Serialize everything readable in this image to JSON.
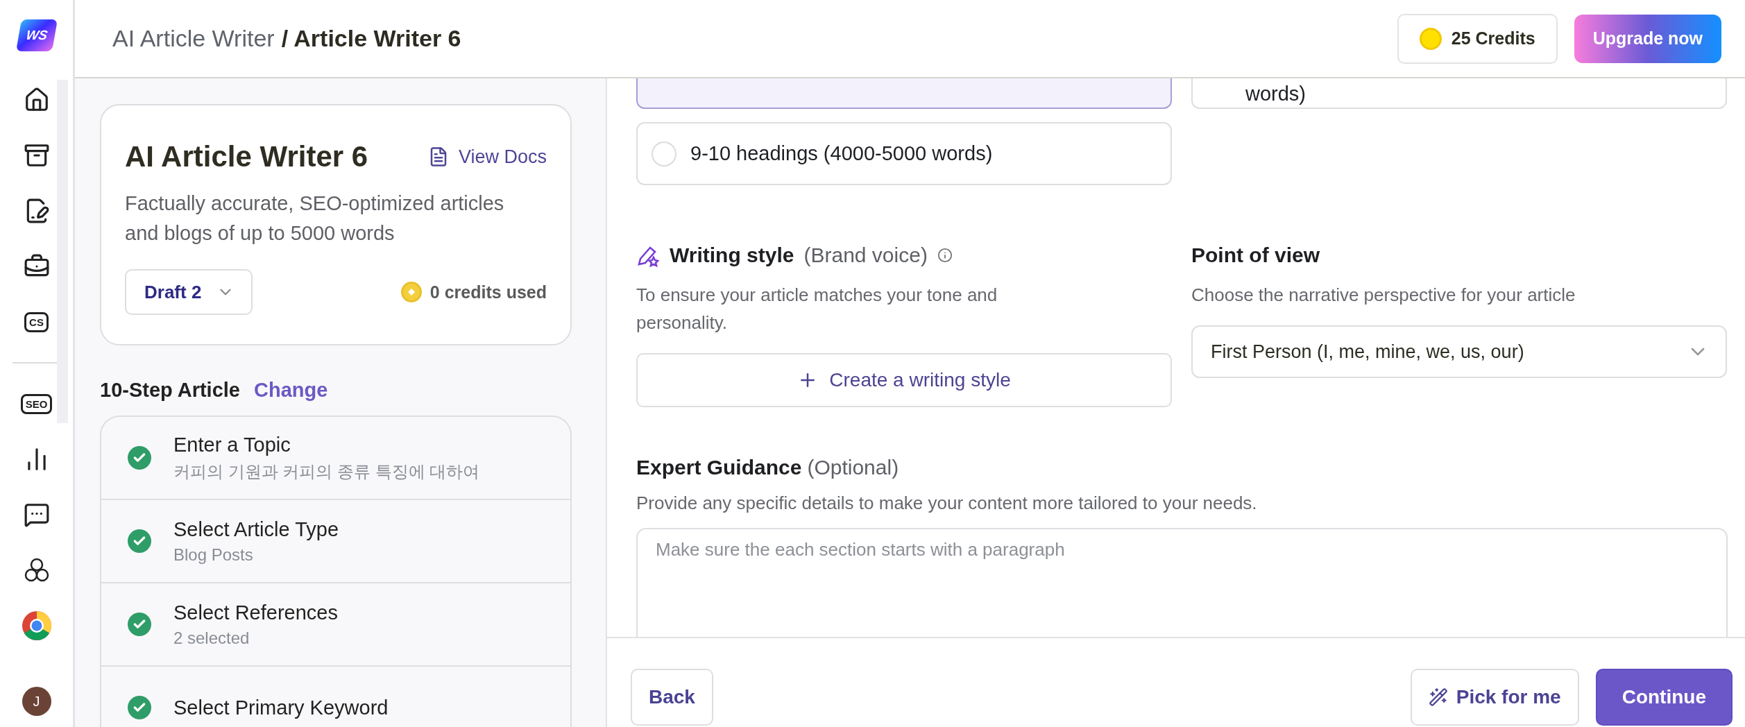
{
  "nav": {
    "logo": "WS",
    "items": [
      {
        "kind": "icon"
      },
      {
        "kind": "icon"
      },
      {
        "kind": "icon"
      },
      {
        "kind": "icon"
      },
      {
        "kind": "badge",
        "label": "CS"
      },
      {
        "kind": "divider"
      },
      {
        "kind": "badge",
        "label": "SEO"
      },
      {
        "kind": "icon"
      },
      {
        "kind": "icon"
      },
      {
        "kind": "icon"
      },
      {
        "kind": "chrome"
      }
    ],
    "avatar": "J"
  },
  "breadcrumb": [
    {
      "label": "AI Article Writer",
      "current": false
    },
    {
      "label": "/ Article Writer 6",
      "current": true
    }
  ],
  "credits": "25 Credits",
  "upgrade": "Upgrade now",
  "tool_card": {
    "title": "AI Article Writer 6",
    "docs_link": "View Docs",
    "description": "Factually accurate, SEO-optimized articles and blogs of up to 5000 words",
    "draft": "Draft 2",
    "credits_used": "0 credits used"
  },
  "steps_header": {
    "title": "10-Step Article",
    "action": "Change"
  },
  "steps": [
    {
      "title": "Enter a Topic",
      "subtitle": "커피의 기원과 커피의 종류 특징에 대하여",
      "done": true
    },
    {
      "title": "Select Article Type",
      "subtitle": "Blog Posts",
      "done": true
    },
    {
      "title": "Select References",
      "subtitle": "2 selected",
      "done": true
    },
    {
      "title": "Select Primary Keyword",
      "done": true
    }
  ],
  "length_options": [
    {
      "selected": true
    },
    {
      "label": "words)",
      "selected": false
    },
    {
      "label": "9-10 headings (4000-5000 words)",
      "selected": false
    }
  ],
  "writing_style": {
    "title": "Writing style",
    "note": "(Brand voice)",
    "description": "To ensure your article matches your tone and personality.",
    "button": "Create a writing style"
  },
  "point_of_view": {
    "title": "Point of view",
    "description": "Choose the narrative perspective for your article",
    "value": "First Person (I, me, mine, we, us, our)"
  },
  "expert_guidance": {
    "title": "Expert Guidance",
    "note": "(Optional)",
    "description": "Provide any specific details to make your content more tailored to your needs.",
    "placeholder": "Make sure the each section starts with a paragraph"
  },
  "footer": {
    "back": "Back",
    "pick": "Pick for me",
    "continue": "Continue"
  }
}
